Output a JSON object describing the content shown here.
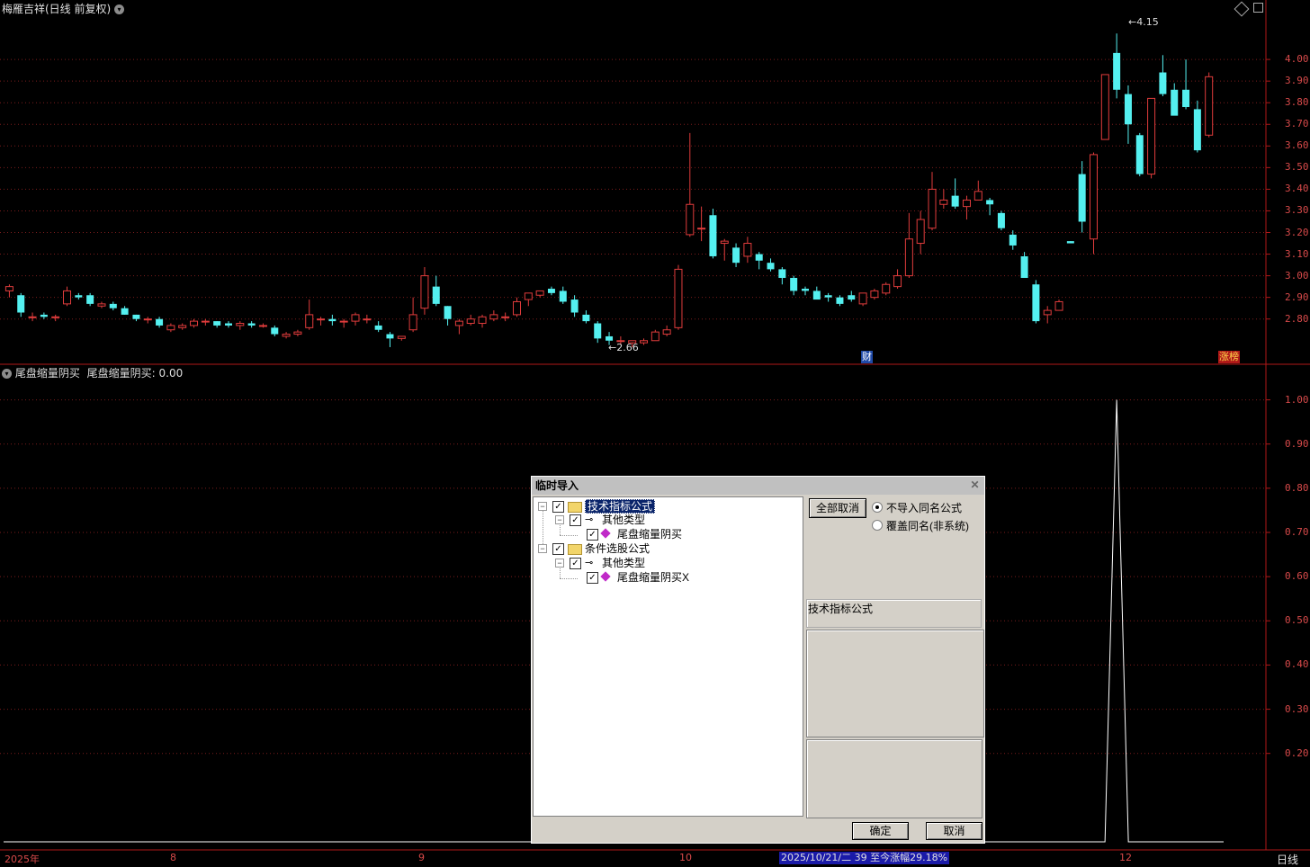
{
  "main_title": "梅雁吉祥(日线 前复权)",
  "indicator_title": "尾盘缩量阴买",
  "indicator_value_label": "尾盘缩量阴买: 0.00",
  "top_right_icons": [
    "diamond-icon",
    "restore-icon"
  ],
  "price_axis": [
    "4.00",
    "3.90",
    "3.80",
    "3.70",
    "3.60",
    "3.50",
    "3.40",
    "3.30",
    "3.20",
    "3.10",
    "3.00",
    "2.90",
    "2.80"
  ],
  "indicator_axis": [
    "1.00",
    "0.90",
    "0.80",
    "0.70",
    "0.60",
    "0.50",
    "0.40",
    "0.30",
    "0.20"
  ],
  "high_marker": "4.15",
  "low_marker": "2.66",
  "badges": {
    "finance": "财",
    "limit_list": "涨榜"
  },
  "time_axis": {
    "year": "2025年",
    "m8": "8",
    "m9": "9",
    "m10": "10",
    "m12": "12",
    "period": "日线"
  },
  "status_text": "2025/10/21/二 39 至今涨幅29.18%",
  "colors": {
    "up": "#e03c3c",
    "down": "#54f0f0",
    "axis": "#b01818",
    "grid": "#7a1c1c"
  },
  "chart_data": {
    "type": "candlestick",
    "ylim": [
      2.62,
      4.2
    ],
    "candles": [
      [
        2.93,
        2.96,
        2.9,
        2.95
      ],
      [
        2.91,
        2.92,
        2.81,
        2.83
      ],
      [
        2.81,
        2.83,
        2.79,
        2.81
      ],
      [
        2.82,
        2.83,
        2.8,
        2.81
      ],
      [
        2.81,
        2.82,
        2.79,
        2.81
      ],
      [
        2.87,
        2.95,
        2.86,
        2.93
      ],
      [
        2.91,
        2.92,
        2.89,
        2.9
      ],
      [
        2.91,
        2.92,
        2.86,
        2.87
      ],
      [
        2.86,
        2.88,
        2.85,
        2.87
      ],
      [
        2.87,
        2.88,
        2.84,
        2.85
      ],
      [
        2.85,
        2.86,
        2.82,
        2.82
      ],
      [
        2.82,
        2.82,
        2.79,
        2.8
      ],
      [
        2.8,
        2.81,
        2.78,
        2.8
      ],
      [
        2.8,
        2.81,
        2.76,
        2.77
      ],
      [
        2.75,
        2.78,
        2.74,
        2.77
      ],
      [
        2.76,
        2.78,
        2.75,
        2.77
      ],
      [
        2.77,
        2.8,
        2.76,
        2.79
      ],
      [
        2.79,
        2.8,
        2.77,
        2.79
      ],
      [
        2.79,
        2.79,
        2.76,
        2.77
      ],
      [
        2.78,
        2.79,
        2.76,
        2.77
      ],
      [
        2.77,
        2.79,
        2.75,
        2.78
      ],
      [
        2.78,
        2.79,
        2.76,
        2.77
      ],
      [
        2.77,
        2.78,
        2.76,
        2.77
      ],
      [
        2.76,
        2.77,
        2.72,
        2.73
      ],
      [
        2.72,
        2.74,
        2.71,
        2.73
      ],
      [
        2.73,
        2.75,
        2.72,
        2.74
      ],
      [
        2.76,
        2.89,
        2.75,
        2.82
      ],
      [
        2.8,
        2.81,
        2.77,
        2.8
      ],
      [
        2.8,
        2.82,
        2.77,
        2.79
      ],
      [
        2.79,
        2.8,
        2.76,
        2.79
      ],
      [
        2.79,
        2.83,
        2.77,
        2.82
      ],
      [
        2.8,
        2.82,
        2.78,
        2.8
      ],
      [
        2.77,
        2.79,
        2.74,
        2.75
      ],
      [
        2.73,
        2.74,
        2.67,
        2.71
      ],
      [
        2.71,
        2.72,
        2.7,
        2.72
      ],
      [
        2.75,
        2.9,
        2.74,
        2.82
      ],
      [
        2.85,
        3.04,
        2.82,
        3.0
      ],
      [
        2.95,
        3.0,
        2.86,
        2.87
      ],
      [
        2.86,
        2.86,
        2.77,
        2.8
      ],
      [
        2.77,
        2.8,
        2.73,
        2.79
      ],
      [
        2.78,
        2.82,
        2.77,
        2.8
      ],
      [
        2.78,
        2.82,
        2.76,
        2.81
      ],
      [
        2.8,
        2.84,
        2.79,
        2.82
      ],
      [
        2.81,
        2.83,
        2.79,
        2.81
      ],
      [
        2.82,
        2.9,
        2.81,
        2.88
      ],
      [
        2.89,
        2.92,
        2.86,
        2.92
      ],
      [
        2.91,
        2.93,
        2.9,
        2.93
      ],
      [
        2.94,
        2.95,
        2.91,
        2.92
      ],
      [
        2.93,
        2.95,
        2.87,
        2.88
      ],
      [
        2.89,
        2.91,
        2.81,
        2.83
      ],
      [
        2.82,
        2.84,
        2.78,
        2.79
      ],
      [
        2.78,
        2.79,
        2.69,
        2.71
      ],
      [
        2.72,
        2.74,
        2.68,
        2.7
      ],
      [
        2.7,
        2.72,
        2.68,
        2.7
      ],
      [
        2.69,
        2.7,
        2.67,
        2.7
      ],
      [
        2.69,
        2.71,
        2.68,
        2.7
      ],
      [
        2.7,
        2.75,
        2.7,
        2.74
      ],
      [
        2.73,
        2.77,
        2.72,
        2.75
      ],
      [
        2.76,
        3.05,
        2.75,
        3.03
      ],
      [
        3.19,
        3.66,
        3.18,
        3.33
      ],
      [
        3.22,
        3.32,
        3.16,
        3.22
      ],
      [
        3.28,
        3.31,
        3.08,
        3.09
      ],
      [
        3.15,
        3.17,
        3.07,
        3.16
      ],
      [
        3.13,
        3.15,
        3.04,
        3.06
      ],
      [
        3.09,
        3.18,
        3.06,
        3.15
      ],
      [
        3.1,
        3.11,
        3.03,
        3.07
      ],
      [
        3.06,
        3.08,
        3.02,
        3.03
      ],
      [
        3.03,
        3.04,
        2.96,
        2.99
      ],
      [
        2.99,
        3.0,
        2.91,
        2.93
      ],
      [
        2.94,
        2.95,
        2.91,
        2.93
      ],
      [
        2.93,
        2.95,
        2.9,
        2.89
      ],
      [
        2.91,
        2.92,
        2.88,
        2.9
      ],
      [
        2.9,
        2.91,
        2.86,
        2.87
      ],
      [
        2.91,
        2.93,
        2.88,
        2.89
      ],
      [
        2.87,
        2.92,
        2.86,
        2.92
      ],
      [
        2.9,
        2.94,
        2.89,
        2.93
      ],
      [
        2.92,
        2.97,
        2.91,
        2.96
      ],
      [
        2.95,
        3.03,
        2.94,
        3.0
      ],
      [
        3.0,
        3.29,
        2.99,
        3.17
      ],
      [
        3.15,
        3.3,
        3.1,
        3.26
      ],
      [
        3.22,
        3.48,
        3.21,
        3.4
      ],
      [
        3.33,
        3.4,
        3.31,
        3.35
      ],
      [
        3.37,
        3.45,
        3.31,
        3.32
      ],
      [
        3.32,
        3.37,
        3.26,
        3.35
      ],
      [
        3.35,
        3.44,
        3.35,
        3.39
      ],
      [
        3.35,
        3.36,
        3.28,
        3.33
      ],
      [
        3.29,
        3.3,
        3.21,
        3.22
      ],
      [
        3.19,
        3.21,
        3.12,
        3.14
      ],
      [
        3.09,
        3.11,
        2.99,
        2.99
      ],
      [
        2.96,
        2.98,
        2.78,
        2.79
      ],
      [
        2.82,
        2.86,
        2.78,
        2.84
      ],
      [
        2.84,
        2.89,
        2.84,
        2.88
      ],
      [
        3.16,
        3.16,
        3.15,
        3.15
      ],
      [
        3.47,
        3.53,
        3.2,
        3.25
      ],
      [
        3.17,
        3.57,
        3.1,
        3.56
      ],
      [
        3.63,
        3.93,
        3.63,
        3.93
      ],
      [
        4.03,
        4.12,
        3.82,
        3.86
      ],
      [
        3.84,
        3.88,
        3.61,
        3.7
      ],
      [
        3.65,
        3.66,
        3.46,
        3.47
      ],
      [
        3.47,
        3.82,
        3.45,
        3.82
      ],
      [
        3.94,
        4.02,
        3.83,
        3.84
      ],
      [
        3.86,
        3.89,
        3.75,
        3.74
      ],
      [
        3.86,
        4.0,
        3.77,
        3.78
      ],
      [
        3.77,
        3.81,
        3.57,
        3.58
      ],
      [
        3.65,
        3.94,
        3.64,
        3.92
      ]
    ],
    "indicator": {
      "peak_index": 96,
      "peak_value": 1.0,
      "ylim": [
        0,
        1.05
      ]
    }
  },
  "dialog": {
    "title": "临时导入",
    "tree": [
      {
        "label": "技术指标公式",
        "selected": true
      },
      {
        "label": "其他类型"
      },
      {
        "label": "尾盘缩量阴买"
      },
      {
        "label": "条件选股公式"
      },
      {
        "label": "其他类型"
      },
      {
        "label": "尾盘缩量阴买X"
      }
    ],
    "cancel_all_button": "全部取消",
    "option_no_import": "不导入同名公式",
    "option_overwrite": "覆盖同名(非系统)",
    "category_field": "技术指标公式",
    "ok_button": "确定",
    "cancel_button": "取消"
  }
}
